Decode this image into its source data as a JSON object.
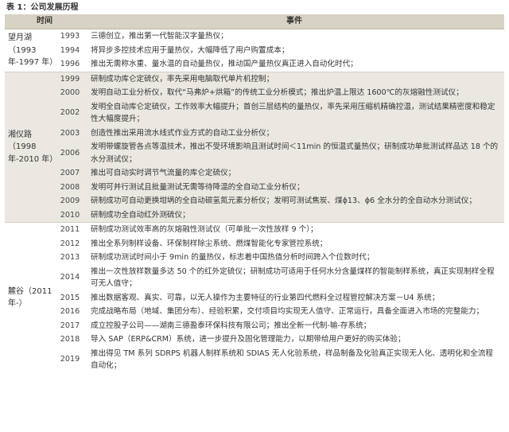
{
  "caption": "表 1：公司发展历程",
  "headers": {
    "period": "时间",
    "event": "事件"
  },
  "groups": [
    {
      "era": "望月湖（1993 年-1997 年）",
      "rows": [
        {
          "year": "1993",
          "event": "三德创立，推出第一代智能汉字量热仪；"
        },
        {
          "year": "1994",
          "event": "将异步多控技术应用于量热仪，大幅降低了用户购置成本；"
        },
        {
          "year": "1996",
          "event": "推出无需称水重、量水温的自动量热仪，推动国产量热仪真正进入自动化时代；"
        }
      ]
    },
    {
      "era": "湘仪路（1998 年-2010 年）",
      "rows": [
        {
          "year": "1999",
          "event": "研制成功库仑定硫仪，率先采用电脑取代单片机控制；"
        },
        {
          "year": "2000",
          "event": "发明自动工业分析仪，取代“马弗炉+烘箱”的传统工业分析模式；推出炉温上限达 1600℃的灰熔融性测试仪；"
        },
        {
          "year": "2002",
          "event": "发明全自动库仑定硫仪，工作效率大幅提升；首创三层结构的量热仪，率先采用压缩机精确控温，测试结果精密度和稳定性大幅度提升；"
        },
        {
          "year": "2003",
          "event": "创造性推出采用流水线式作业方式的自动工业分析仪；"
        },
        {
          "year": "2006",
          "event": "发明带螺旋管各点等温技术，推出不受环境影响且测试时间＜11min 的恒温式量热仪；研制成功单批测试样品达 18 个的水分测试仪；"
        },
        {
          "year": "2007",
          "event": "推出可自动实时调节气流量的库仑定硫仪；"
        },
        {
          "year": "2008",
          "event": "发明可并行测试且批量测试无需等待降温的全自动工业分析仪；"
        },
        {
          "year": "2009",
          "event": "研制成功可自动更换坩埚的全自动碳氢氮元素分析仪；发明可测试焦炭、煤ϕ13、ϕ6 全水分的全自动水分测试仪；"
        },
        {
          "year": "2010",
          "event": "研制成功全自动红外测硫仪；"
        }
      ]
    },
    {
      "era": "麓谷（2011 年-）",
      "rows": [
        {
          "year": "2011",
          "event": "研制成功测试效率高的灰熔融性测试仪（可单批一次性放样 9 个）；"
        },
        {
          "year": "2012",
          "event": "推出全系列制样设备、环保制样除尘系统、燃煤智能化专家管控系统；"
        },
        {
          "year": "2013",
          "event": "研制成功测试时间小于 9min 的量热仪，标志着中国热值分析时间跨入个位数时代；"
        },
        {
          "year": "2014",
          "event": "推出一次性放样数量多达 50 个的红外定硫仪；研制成功可适用于任何水分含量煤样的智能制样系统，真正实现制样全程可无人值守；"
        },
        {
          "year": "2015",
          "event": "推出数据客观、真实、可靠，以无人操作为主要特征的行业第四代燃料全过程管控解决方案－U4 系统；"
        },
        {
          "year": "2016",
          "event": "完成战略布局（地域、集团分布）、经验积累，交付项目均实现无人值守、正常运行，具备全面进入市场的完整能力；"
        },
        {
          "year": "2017",
          "event": "成立控股子公司——湖南三德盈泰环保科技有限公司；推出全新一代制-输-存系统；"
        },
        {
          "year": "2018",
          "event": "导入 SAP（ERP&CRM）系统，进一步提升及固化管理能力，以期带给用户更好的购买体验；"
        },
        {
          "year": "2019",
          "event": "推出得见 TM 系列 SDRPS 机器人制样系统和 SDIAS 无人化验系统，样品制备及化验真正实现无人化、透明化和全流程自动化；"
        }
      ]
    }
  ]
}
